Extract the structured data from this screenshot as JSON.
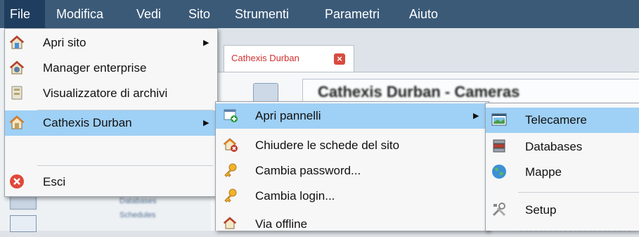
{
  "menubar": {
    "items": [
      "File",
      "Modifica",
      "Vedi",
      "Sito",
      "Strumenti",
      "Parametri",
      "Aiuto"
    ]
  },
  "tab": {
    "label": "Cathexis Durban"
  },
  "content": {
    "title": "Cathexis Durban - Cameras",
    "blur_items": [
      "Databases",
      "Schedules"
    ]
  },
  "file_menu": {
    "items": [
      {
        "label": "Apri sito",
        "icon": "house-icon",
        "submenu": true
      },
      {
        "label": "Manager enterprise",
        "icon": "enterprise-icon",
        "submenu": false
      },
      {
        "label": "Visualizzatore di archivi",
        "icon": "archive-icon",
        "submenu": false
      },
      {
        "label": "Cathexis Durban",
        "icon": "house-icon",
        "submenu": true
      },
      {
        "label": "Esci",
        "icon": "exit-icon",
        "submenu": false
      }
    ]
  },
  "site_menu": {
    "items": [
      {
        "label": "Apri pannelli",
        "icon": "open-panel-icon",
        "submenu": true
      },
      {
        "label": "Chiudere le schede del sito",
        "icon": "close-site-icon"
      },
      {
        "label": "Cambia password...",
        "icon": "key-icon"
      },
      {
        "label": "Cambia login...",
        "icon": "key-icon"
      },
      {
        "label": "Via offline",
        "icon": "offline-icon"
      }
    ]
  },
  "panels_menu": {
    "items": [
      {
        "label": "Telecamere",
        "icon": "camera-panel-icon"
      },
      {
        "label": "Databases",
        "icon": "database-icon"
      },
      {
        "label": "Mappe",
        "icon": "globe-icon"
      },
      {
        "label": "Setup",
        "icon": "tools-icon"
      }
    ]
  },
  "colors": {
    "menubar": "#3b5a78",
    "highlight": "#9fd0f5",
    "menu_bg": "#f7f7f7"
  }
}
